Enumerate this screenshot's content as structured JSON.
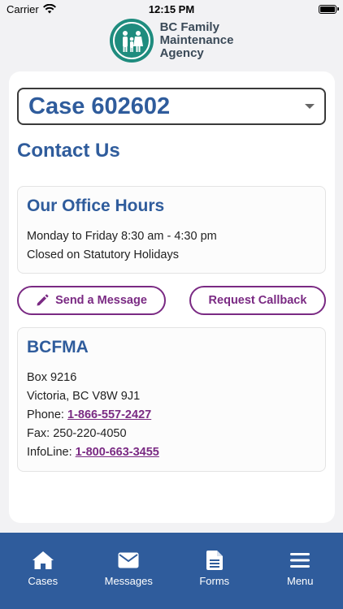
{
  "status_bar": {
    "carrier": "Carrier",
    "time": "12:15 PM"
  },
  "header": {
    "logo_line1": "BC Family",
    "logo_line2": "Maintenance",
    "logo_line3": "Agency"
  },
  "case_selector": {
    "selected": "Case 602602"
  },
  "page_title": "Contact Us",
  "office_hours": {
    "title": "Our Office Hours",
    "line1": "Monday to Friday 8:30 am - 4:30 pm",
    "line2": "Closed on Statutory Holidays"
  },
  "actions": {
    "send_message": "Send a Message",
    "request_callback": "Request Callback"
  },
  "contact": {
    "title": "BCFMA",
    "address1": "Box 9216",
    "address2": "Victoria, BC V8W 9J1",
    "phone_label": "Phone: ",
    "phone": "1-866-557-2427",
    "fax": "Fax: 250-220-4050",
    "infoline_label": "InfoLine: ",
    "infoline": "1-800-663-3455"
  },
  "tabs": [
    {
      "label": "Cases",
      "icon": "home-icon"
    },
    {
      "label": "Messages",
      "icon": "envelope-icon"
    },
    {
      "label": "Forms",
      "icon": "document-icon"
    },
    {
      "label": "Menu",
      "icon": "hamburger-icon"
    }
  ],
  "colors": {
    "primary_blue": "#2f5c9c",
    "accent_purple": "#7a2a83",
    "logo_teal": "#1f8c7e"
  }
}
